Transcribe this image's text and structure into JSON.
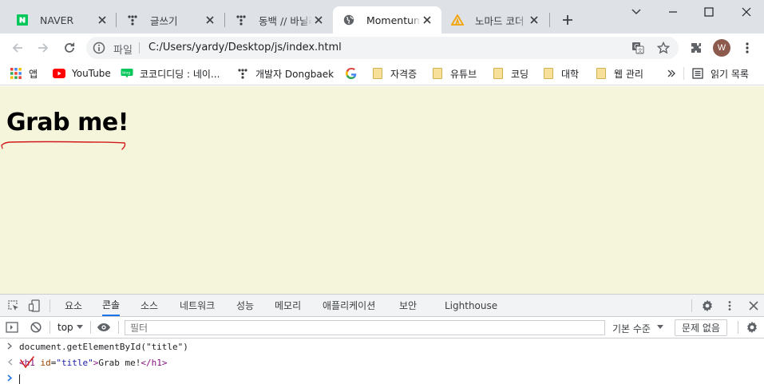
{
  "tabs": [
    {
      "title": "NAVER",
      "favicon": "naver-icon",
      "active": false
    },
    {
      "title": "글쓰기",
      "favicon": "tistory-icon",
      "active": false
    },
    {
      "title": "동백 // 바닐라",
      "favicon": "tistory-icon",
      "active": false
    },
    {
      "title": "Momentum",
      "favicon": "globe-icon",
      "active": true
    },
    {
      "title": "노마드 코더",
      "favicon": "nomad-coders-icon",
      "active": false
    }
  ],
  "toolbar": {
    "scheme_label": "파일",
    "url": "C:/Users/yardy/Desktop/js/index.html",
    "avatar_letter": "W"
  },
  "bookmarks": [
    {
      "label": "앱",
      "icon": "apps-grid-icon"
    },
    {
      "label": "YouTube",
      "icon": "youtube-icon"
    },
    {
      "label": "코코디디딩 : 네이...",
      "icon": "naver-blog-icon"
    },
    {
      "label": "개발자 Dongbaek",
      "icon": "tistory-icon"
    },
    {
      "label": "",
      "icon": "google-icon"
    },
    {
      "label": "자격증",
      "icon": "folder-icon"
    },
    {
      "label": "유튜브",
      "icon": "folder-icon"
    },
    {
      "label": "코딩",
      "icon": "folder-icon"
    },
    {
      "label": "대학",
      "icon": "folder-icon"
    },
    {
      "label": "웹 관리",
      "icon": "folder-icon"
    }
  ],
  "reading_list_label": "읽기 목록",
  "page": {
    "heading": "Grab me!",
    "background": "#f5f5dc"
  },
  "devtools": {
    "tabs": [
      {
        "label": "요소",
        "active": false
      },
      {
        "label": "콘솔",
        "active": true
      },
      {
        "label": "소스",
        "active": false
      },
      {
        "label": "네트워크",
        "active": false
      },
      {
        "label": "성능",
        "active": false
      },
      {
        "label": "메모리",
        "active": false
      },
      {
        "label": "애플리케이션",
        "active": false
      },
      {
        "label": "보안",
        "active": false
      },
      {
        "label": "Lighthouse",
        "active": false
      }
    ],
    "context": "top",
    "filter_placeholder": "필터",
    "levels_label": "기본 수준",
    "issues_label": "문제 없음",
    "console": {
      "input_line": "document.getElementById(\"title\")",
      "result_tag_open": "<h1",
      "result_attr_name": "id",
      "result_attr_value": "\"title\"",
      "result_text": "Grab me!",
      "result_tag_close": "</h1>"
    }
  },
  "colors": {
    "accent": "#1a73e8",
    "annotation_red": "#d11a1a"
  }
}
